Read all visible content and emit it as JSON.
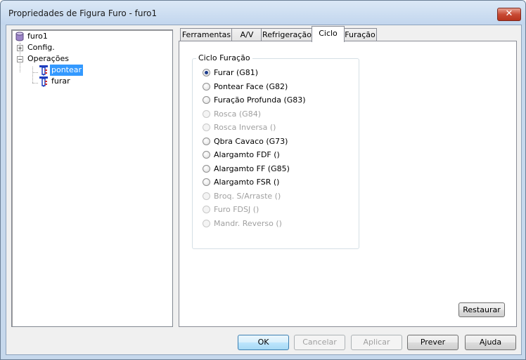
{
  "window": {
    "title": "Propriedades de Figura Furo - furo1",
    "close_glyph": "✕"
  },
  "tree": {
    "root_label": "furo1",
    "items": [
      {
        "label": "Config.",
        "expander": "+"
      },
      {
        "label": "Operações",
        "expander": "−"
      }
    ],
    "children": [
      {
        "label": "pontear",
        "selected": true
      },
      {
        "label": "furar",
        "selected": false
      }
    ]
  },
  "tabs": [
    "Ferramentas",
    "A/V",
    "Refrigeração",
    "Ciclo",
    "Furação"
  ],
  "active_tab": "Ciclo",
  "cycle_group": {
    "title": "Ciclo Furação",
    "options": [
      {
        "label": "Furar (G81)",
        "checked": true,
        "enabled": true
      },
      {
        "label": "Pontear Face (G82)",
        "checked": false,
        "enabled": true
      },
      {
        "label": "Furação Profunda (G83)",
        "checked": false,
        "enabled": true
      },
      {
        "label": "Rosca (G84)",
        "checked": false,
        "enabled": false
      },
      {
        "label": "Rosca Inversa ()",
        "checked": false,
        "enabled": false
      },
      {
        "label": "Qbra Cavaco (G73)",
        "checked": false,
        "enabled": true
      },
      {
        "label": "Alargamto FDF ()",
        "checked": false,
        "enabled": true
      },
      {
        "label": "Alargamto FF (G85)",
        "checked": false,
        "enabled": true
      },
      {
        "label": "Alargamto FSR ()",
        "checked": false,
        "enabled": true
      },
      {
        "label": "Broq. S/Arraste ()",
        "checked": false,
        "enabled": false
      },
      {
        "label": "Furo FDSJ ()",
        "checked": false,
        "enabled": false
      },
      {
        "label": "Mandr. Reverso ()",
        "checked": false,
        "enabled": false
      }
    ]
  },
  "restore_button": "Restaurar",
  "buttons": {
    "ok": "OK",
    "cancel": "Cancelar",
    "apply": "Aplicar",
    "preview": "Prever",
    "help": "Ajuda"
  },
  "icons": {
    "root": "database-cylinder-icon",
    "operation": "drill-tool-icon"
  },
  "colors": {
    "selection": "#3399ff",
    "close": "#c84a34",
    "drill_icon": "#1f3fbf"
  }
}
